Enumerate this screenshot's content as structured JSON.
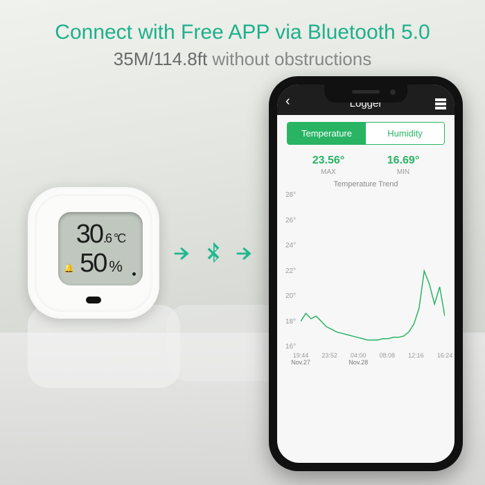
{
  "heading": {
    "main": "Connect with Free APP via Bluetooth 5.0",
    "sub_strong": "35M/114.8ft",
    "sub_rest": " without obstructions"
  },
  "sensor": {
    "temp_int": "30",
    "temp_dec": ".6",
    "temp_unit": "°C",
    "hum_int": "50",
    "hum_unit": "%"
  },
  "phone": {
    "title": "Logger",
    "tabs": {
      "temperature": "Temperature",
      "humidity": "Humidity"
    },
    "stats": {
      "max_val": "23.56°",
      "max_lab": "MAX",
      "min_val": "16.69°",
      "min_lab": "MIN"
    },
    "trend_title": "Temperature Trend"
  },
  "chart_data": {
    "type": "line",
    "title": "Temperature Trend",
    "ylabel": "°",
    "ylim": [
      16,
      28
    ],
    "yticks": [
      28,
      26,
      24,
      22,
      20,
      18,
      16
    ],
    "x": [
      "19:44",
      "23:52",
      "04:00",
      "08:08",
      "12:16",
      "16:24"
    ],
    "x_dates": {
      "19:44": "Nov.27",
      "04:00": "Nov.28"
    },
    "series": [
      {
        "name": "Temperature",
        "color": "#28b463",
        "values": [
          18.2,
          18.8,
          18.4,
          18.6,
          18.2,
          17.8,
          17.6,
          17.4,
          17.3,
          17.2,
          17.1,
          17.0,
          16.9,
          16.8,
          16.8,
          16.8,
          16.9,
          16.9,
          17.0,
          17.0,
          17.1,
          17.4,
          18.0,
          19.2,
          22.0,
          21.0,
          19.5,
          20.8,
          18.6
        ]
      }
    ]
  }
}
